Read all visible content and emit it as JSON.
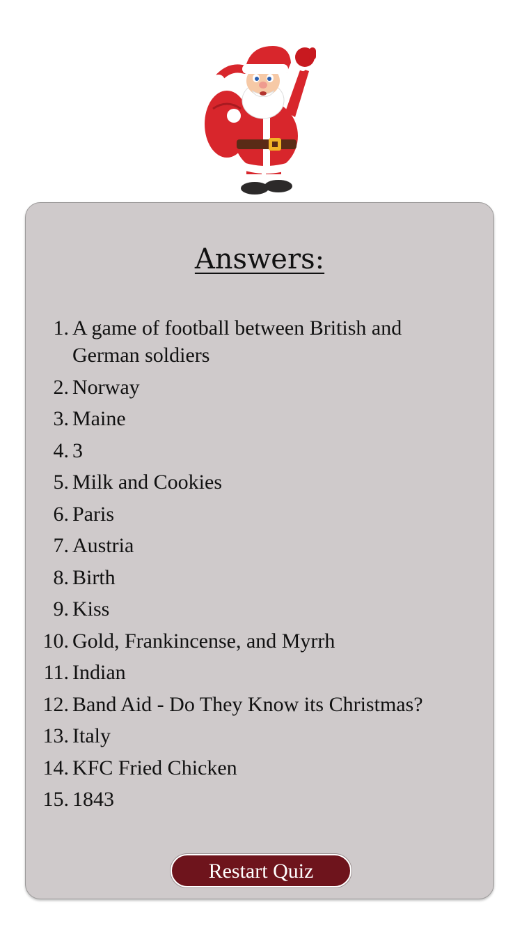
{
  "answers_card": {
    "title": "Answers:",
    "items": [
      {
        "num": "1.",
        "text": "A game of football between British and German soldiers"
      },
      {
        "num": "2.",
        "text": "Norway"
      },
      {
        "num": "3.",
        "text": "Maine"
      },
      {
        "num": "4.",
        "text": "3"
      },
      {
        "num": "5.",
        "text": "Milk and Cookies"
      },
      {
        "num": "6.",
        "text": "Paris"
      },
      {
        "num": "7.",
        "text": "Austria"
      },
      {
        "num": "8.",
        "text": "Birth"
      },
      {
        "num": "9.",
        "text": "Kiss"
      },
      {
        "num": "10.",
        "text": "Gold, Frankincense, and Myrrh"
      },
      {
        "num": "11.",
        "text": "Indian"
      },
      {
        "num": "12.",
        "text": "Band Aid - Do They Know its Christmas?"
      },
      {
        "num": "13.",
        "text": "Italy"
      },
      {
        "num": "14.",
        "text": "KFC Fried Chicken"
      },
      {
        "num": "15.",
        "text": "1843"
      }
    ],
    "restart_label": "Restart Quiz"
  },
  "colors": {
    "card_background": "#cfcacb",
    "button_background": "#6e141c",
    "santa_red": "#d8262c"
  },
  "icons": {
    "header_image": "santa-claus-waving-icon"
  }
}
